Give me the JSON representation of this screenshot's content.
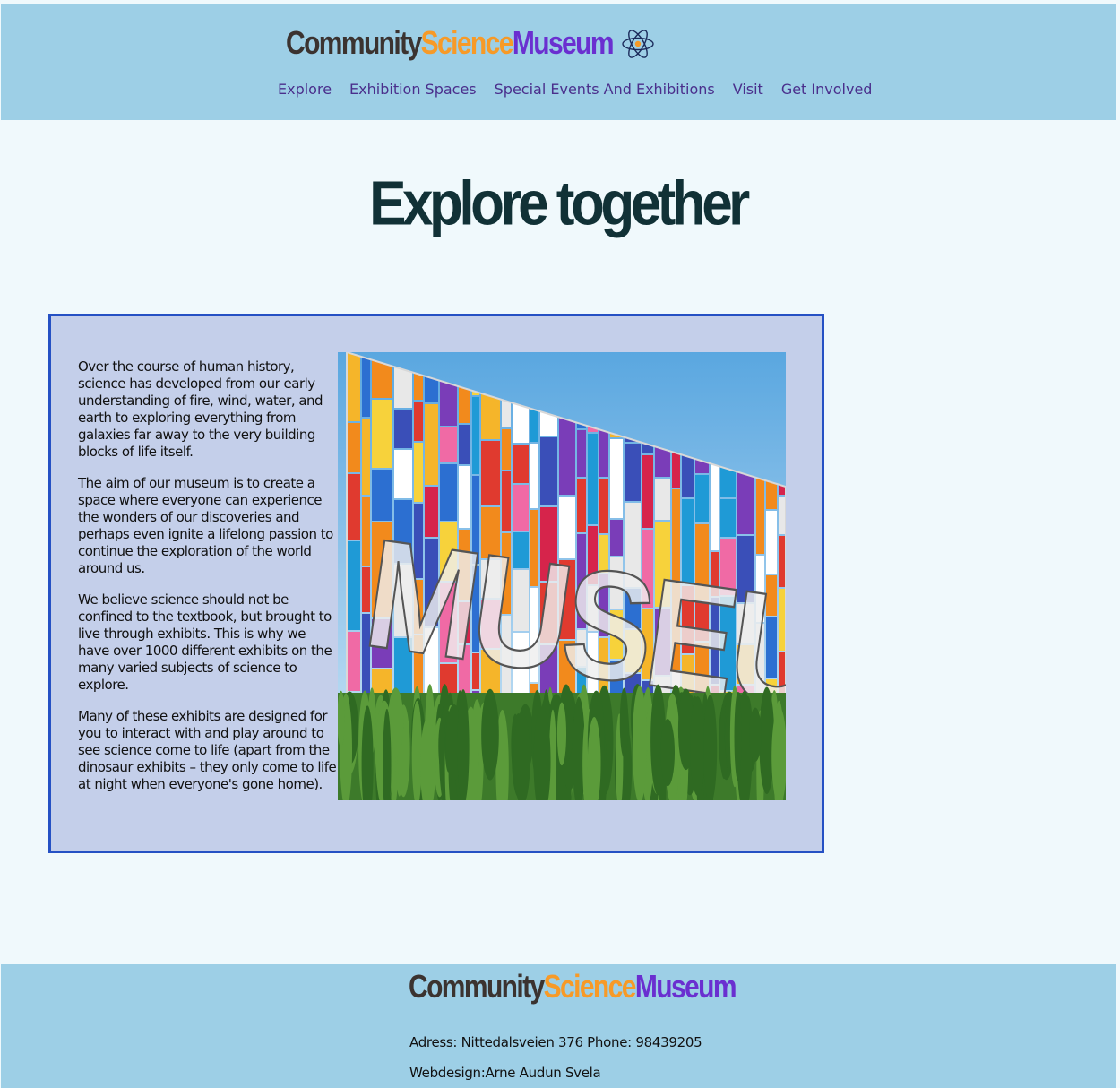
{
  "header": {
    "logo": {
      "part1": "Community",
      "part2": "Science",
      "part3": "Museum"
    },
    "icon": "atom-icon",
    "nav": [
      "Explore",
      "Exhibition Spaces",
      "Special Events And Exhibitions",
      "Visit",
      "Get Involved"
    ]
  },
  "main": {
    "title": "Explore together",
    "paragraphs": [
      "Over the course of human history, science has developed from our early understanding of fire, wind, water, and earth to exploring everything from galaxies far away to the very building blocks of life itself.",
      "The aim of our museum is to create a space where everyone can experience the wonders of our discoveries and perhaps even ignite a lifelong passion to continue the exploration of the world around us.",
      "We believe science should not be confined to the textbook, but brought to live through exhibits. This is why we have over 1000 different exhibits on the many varied subjects of science to explore.",
      "Many of these exhibits are designed for you to interact with and play around to see science come to life (apart from the dinosaur exhibits – they only come to life at night when everyone's gone home)."
    ],
    "image": {
      "sign_text": "MUSEUM"
    }
  },
  "footer": {
    "logo": {
      "part1": "Community",
      "part2": "Science",
      "part3": "Museum"
    },
    "address": "Adress: Nittedalsveien 376 Phone: 98439205",
    "credit": "Webdesign:Arne Audun Svela"
  },
  "colors": {
    "header_bg": "#9dcfe6",
    "page_bg": "#f0f9fc",
    "panel_bg": "#c4cfea",
    "panel_border": "#2551c4",
    "nav_link": "#4a2f8c",
    "title": "#113136",
    "logo_dark": "#3b3330",
    "logo_orange": "#f79a27",
    "logo_purple": "#6a2fd0"
  }
}
